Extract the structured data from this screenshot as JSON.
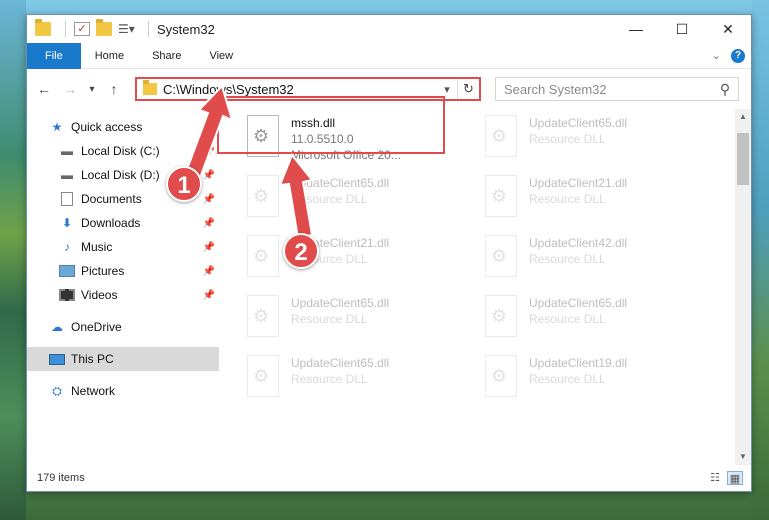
{
  "window": {
    "title": "System32",
    "controls": {
      "minimize": "—",
      "maximize": "☐",
      "close": "✕"
    }
  },
  "ribbon": {
    "tabs": [
      "File",
      "Home",
      "Share",
      "View"
    ]
  },
  "navigation": {
    "back": "←",
    "forward": "→",
    "recent": "▾",
    "up": "↑",
    "address": "C:\\Windows\\System32",
    "search_placeholder": "Search System32"
  },
  "sidebar": {
    "quick_access": "Quick access",
    "items": [
      {
        "label": "Local Disk (C:)",
        "icon": "disk-icon"
      },
      {
        "label": "Local Disk (D:)",
        "icon": "disk-icon"
      },
      {
        "label": "Documents",
        "icon": "documents-icon"
      },
      {
        "label": "Downloads",
        "icon": "downloads-icon"
      },
      {
        "label": "Music",
        "icon": "music-icon"
      },
      {
        "label": "Pictures",
        "icon": "pictures-icon"
      },
      {
        "label": "Videos",
        "icon": "videos-icon"
      }
    ],
    "onedrive": "OneDrive",
    "this_pc": "This PC",
    "network": "Network"
  },
  "files": {
    "highlighted": {
      "name": "mssh.dll",
      "version": "11.0.5510.0",
      "company": "Microsoft Office 20..."
    },
    "faded": [
      {
        "name": "UpdateClient65.dll",
        "type": "Resource DLL"
      },
      {
        "name": "UpdateClient65.dll",
        "type": "Resource DLL"
      },
      {
        "name": "UpdateClient21.dll",
        "type": "Resource DLL"
      },
      {
        "name": "UpdateClient21.dll",
        "type": "Resource DLL"
      },
      {
        "name": "UpdateClient42.dll",
        "type": "Resource DLL"
      },
      {
        "name": "UpdateClient65.dll",
        "type": "Resource DLL"
      },
      {
        "name": "UpdateClient65.dll",
        "type": "Resource DLL"
      },
      {
        "name": "UpdateClient65.dll",
        "type": "Resource DLL"
      },
      {
        "name": "UpdateClient19.dll",
        "type": "Resource DLL"
      }
    ]
  },
  "annotations": {
    "step1": "1",
    "step2": "2",
    "accent": "#e04b4b"
  },
  "status": {
    "item_count": "179 items"
  }
}
